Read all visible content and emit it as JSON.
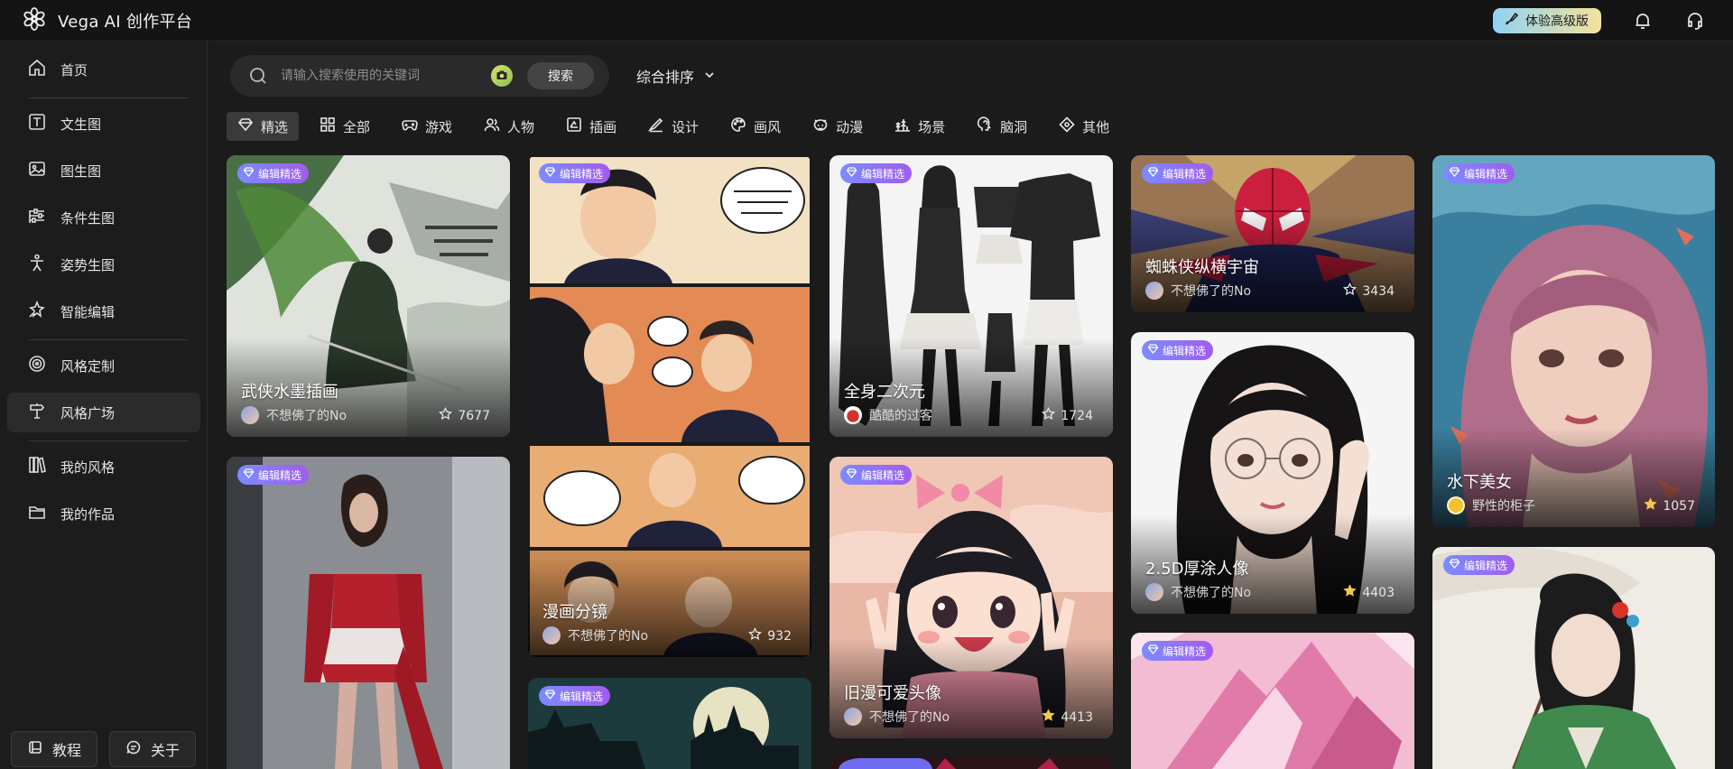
{
  "app": {
    "title": "Vega AI 创作平台"
  },
  "header": {
    "upgrade_label": "体验高级版",
    "icons": [
      "bell-icon",
      "headset-icon"
    ]
  },
  "sidebar": {
    "items": [
      {
        "label": "首页",
        "icon": "home-icon"
      },
      {
        "label": "文生图",
        "icon": "text-icon"
      },
      {
        "label": "图生图",
        "icon": "image-icon"
      },
      {
        "label": "条件生图",
        "icon": "sliders-icon"
      },
      {
        "label": "姿势生图",
        "icon": "pose-icon"
      },
      {
        "label": "智能编辑",
        "icon": "magic-icon"
      },
      {
        "label": "风格定制",
        "icon": "target-icon"
      },
      {
        "label": "风格广场",
        "icon": "signpost-icon",
        "active": true
      },
      {
        "label": "我的风格",
        "icon": "books-icon"
      },
      {
        "label": "我的作品",
        "icon": "folder-icon"
      }
    ],
    "footer": {
      "tutorial": "教程",
      "about": "关于"
    }
  },
  "search": {
    "placeholder": "请输入搜索使用的关键词",
    "button": "搜索"
  },
  "sort": {
    "label": "综合排序"
  },
  "tabs": [
    {
      "label": "精选",
      "icon": "diamond-icon",
      "active": true
    },
    {
      "label": "全部",
      "icon": "grid-icon"
    },
    {
      "label": "游戏",
      "icon": "gamepad-icon"
    },
    {
      "label": "人物",
      "icon": "people-icon"
    },
    {
      "label": "插画",
      "icon": "illustration-icon"
    },
    {
      "label": "设计",
      "icon": "pen-icon"
    },
    {
      "label": "画风",
      "icon": "palette-icon"
    },
    {
      "label": "动漫",
      "icon": "anime-icon"
    },
    {
      "label": "场景",
      "icon": "scene-icon"
    },
    {
      "label": "脑洞",
      "icon": "brain-icon"
    },
    {
      "label": "其他",
      "icon": "other-icon"
    }
  ],
  "cards": [
    {
      "badge": "编辑精选",
      "title": "武侠水墨插画",
      "author": "不想佛了的No",
      "likes": "7677"
    },
    {
      "badge": "编辑精选"
    },
    {
      "badge": "编辑精选",
      "title": "漫画分镜",
      "author": "不想佛了的No",
      "likes": "932"
    },
    {
      "badge": "编辑精选"
    },
    {
      "badge": "编辑精选",
      "title": "全身二次元",
      "author": "酷酷的过客",
      "likes": "1724"
    },
    {
      "badge": "编辑精选",
      "title": "旧漫可爱头像",
      "author": "不想佛了的No",
      "likes": "4413"
    },
    {
      "badge": "编辑精选",
      "title": "蜘蛛侠纵横宇宙",
      "author": "不想佛了的No",
      "likes": "3434"
    },
    {
      "badge": "编辑精选",
      "title": "2.5D厚涂人像",
      "author": "不想佛了的No",
      "likes": "4403"
    },
    {
      "badge": "编辑精选"
    },
    {
      "badge": "编辑精选",
      "title": "水下美女",
      "author": "野性的柜子",
      "likes": "1057"
    },
    {
      "badge": "编辑精选"
    }
  ]
}
